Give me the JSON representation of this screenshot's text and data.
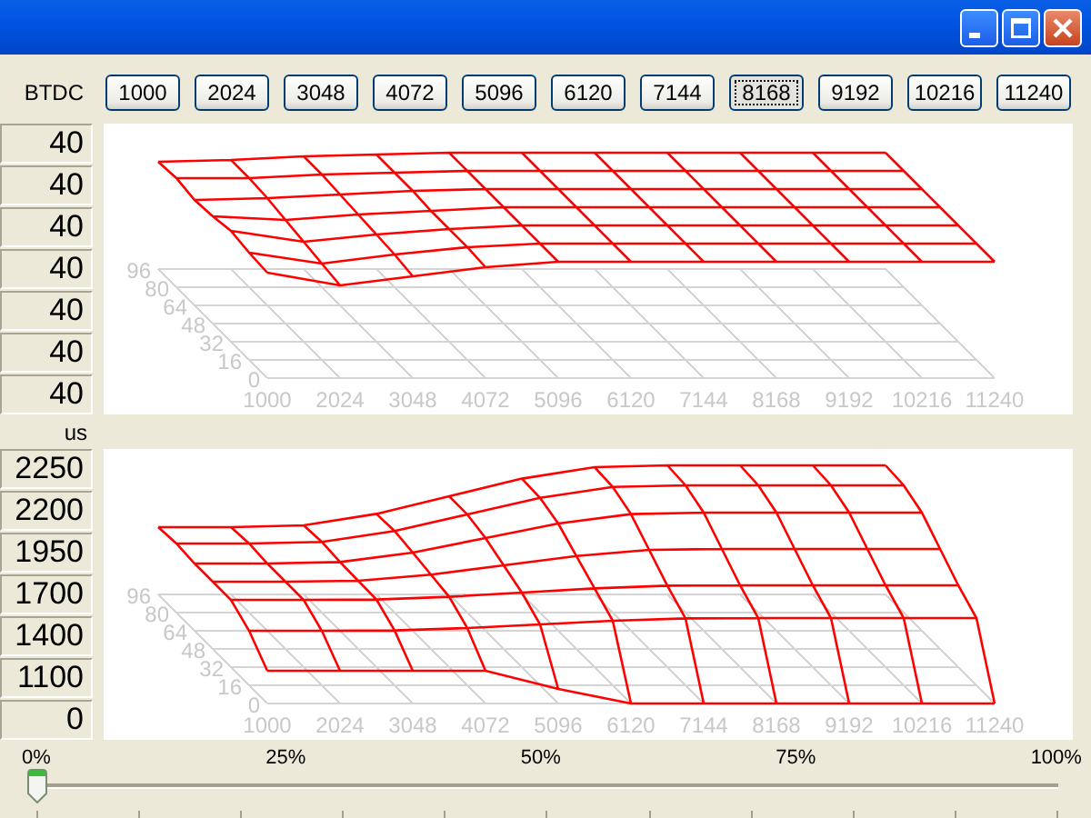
{
  "window": {
    "controls": [
      {
        "kind": "minimize"
      },
      {
        "kind": "maximize"
      },
      {
        "kind": "close"
      }
    ]
  },
  "rpm_buttons": [
    {
      "label": "1000",
      "selected": false
    },
    {
      "label": "2024",
      "selected": false
    },
    {
      "label": "3048",
      "selected": false
    },
    {
      "label": "4072",
      "selected": false
    },
    {
      "label": "5096",
      "selected": false
    },
    {
      "label": "6120",
      "selected": false
    },
    {
      "label": "7144",
      "selected": false
    },
    {
      "label": "8168",
      "selected": true
    },
    {
      "label": "9192",
      "selected": false
    },
    {
      "label": "10216",
      "selected": false
    },
    {
      "label": "11240",
      "selected": false
    }
  ],
  "plots": [
    {
      "unit": "BTDC",
      "values": [
        "40",
        "40",
        "40",
        "40",
        "40",
        "40",
        "40"
      ],
      "x_ticks": [
        "1000",
        "2024",
        "3048",
        "4072",
        "5096",
        "6120",
        "7144",
        "8168",
        "9192",
        "10216",
        "11240"
      ],
      "depth_ticks": [
        "0",
        "16",
        "32",
        "48",
        "64",
        "80",
        "96"
      ],
      "kind": "flat"
    },
    {
      "unit": "us",
      "values": [
        "2250",
        "2200",
        "1950",
        "1700",
        "1400",
        "1100",
        "0"
      ],
      "x_ticks": [
        "1000",
        "2024",
        "3048",
        "4072",
        "5096",
        "6120",
        "7144",
        "8168",
        "9192",
        "10216",
        "11240"
      ],
      "depth_ticks": [
        "0",
        "16",
        "32",
        "48",
        "64",
        "80",
        "96"
      ],
      "kind": "ramp"
    }
  ],
  "slider": {
    "labels": [
      "0%",
      "25%",
      "50%",
      "75%",
      "100%"
    ],
    "level": 0
  }
}
